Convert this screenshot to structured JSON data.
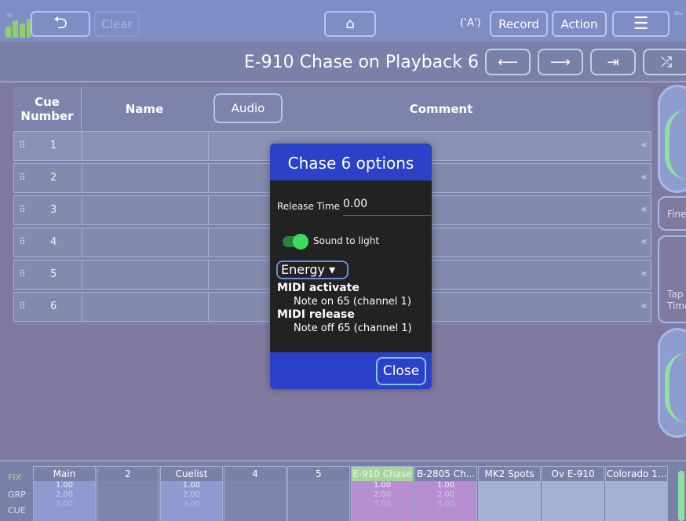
{
  "topbar": {
    "undo_icon": "undo-arrow-icon",
    "clear_label": "Clear",
    "home_icon": "home-icon",
    "broadcast_icon": "broadcast-icon",
    "broadcast_glyph": "(ʿA')",
    "record_label": "Record",
    "action_label": "Action",
    "menu_icon": "hamburger-menu-icon",
    "in_label": "In",
    "out_label": "Ou"
  },
  "title": {
    "text": "E-910 Chase on Playback 6",
    "nav": [
      {
        "icon": "arrow-left-icon",
        "glyph": "⟵"
      },
      {
        "icon": "arrow-right-icon",
        "glyph": "⟶"
      },
      {
        "icon": "skip-end-icon",
        "glyph": "⇥"
      },
      {
        "icon": "shuffle-icon",
        "glyph": "⤮"
      }
    ]
  },
  "table": {
    "headers": {
      "cue_number": "Cue Number",
      "name": "Name",
      "audio": "Audio",
      "comment": "Comment"
    },
    "rows": [
      {
        "num": "1"
      },
      {
        "num": "2"
      },
      {
        "num": "3"
      },
      {
        "num": "4"
      },
      {
        "num": "5"
      },
      {
        "num": "6"
      }
    ]
  },
  "side": {
    "fine_label": "Fine",
    "tap_label": "Tap",
    "time_label": "Time"
  },
  "bottom": {
    "labels": [
      "FIX",
      "GRP",
      "CUE"
    ],
    "playbacks": [
      {
        "name": "Main",
        "v1": "1.00",
        "v2": "2.00",
        "v3": "3.00",
        "style": "blue"
      },
      {
        "name": "2",
        "v1": "",
        "v2": "",
        "v3": "",
        "style": "empty"
      },
      {
        "name": "Cuelist",
        "v1": "1.00",
        "v2": "2.00",
        "v3": "3.00",
        "style": "blue"
      },
      {
        "name": "4",
        "v1": "",
        "v2": "",
        "v3": "",
        "style": "empty"
      },
      {
        "name": "5",
        "v1": "",
        "v2": "",
        "v3": "",
        "style": "empty"
      },
      {
        "name": "E-910 Chase",
        "v1": "1.00",
        "v2": "2.00",
        "v3": "3.00",
        "style": "purple active"
      },
      {
        "name": "B-2805 Ch...",
        "v1": "1.00",
        "v2": "2.00",
        "v3": "3.00",
        "style": "purple"
      },
      {
        "name": "MK2 Spots",
        "v1": "",
        "v2": "",
        "v3": "",
        "style": "light"
      },
      {
        "name": "Ov E-910",
        "v1": "",
        "v2": "",
        "v3": "",
        "style": "light"
      },
      {
        "name": "Colorado 1...",
        "v1": "",
        "v2": "",
        "v3": "",
        "style": "light"
      }
    ]
  },
  "modal": {
    "title": "Chase 6 options",
    "release_label": "Release Time",
    "release_value": "0.00",
    "sound_to_light_label": "Sound to light",
    "sound_to_light_on": true,
    "energy_label": "Energy ▾",
    "midi_activate_label": "MIDI activate",
    "midi_activate_value": "Note on 65 (channel 1)",
    "midi_release_label": "MIDI release",
    "midi_release_value": "Note off 65 (channel 1)",
    "close_label": "Close"
  }
}
